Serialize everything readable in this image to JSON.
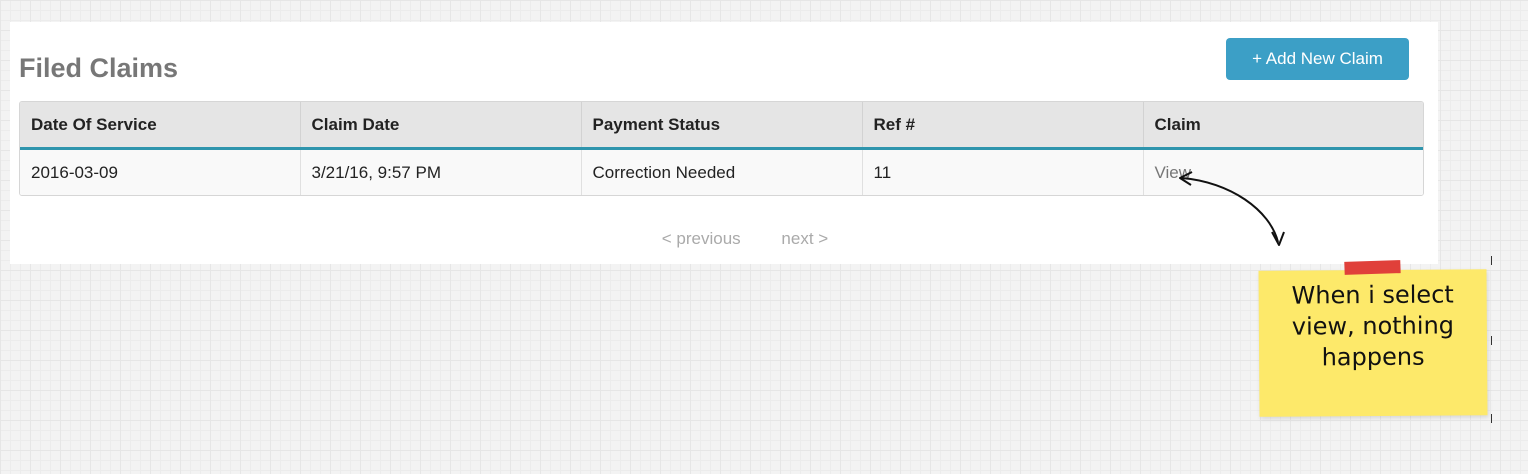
{
  "page": {
    "title": "Filed Claims",
    "add_button_label": "+ Add New Claim"
  },
  "table": {
    "headers": [
      "Date Of Service",
      "Claim Date",
      "Payment Status",
      "Ref #",
      "Claim"
    ],
    "rows": [
      {
        "date_of_service": "2016-03-09",
        "claim_date": "3/21/16, 9:57 PM",
        "payment_status": "Correction Needed",
        "ref": "11",
        "claim_link": "View"
      }
    ]
  },
  "pagination": {
    "previous_label": "< previous",
    "next_label": "next >"
  },
  "annotation": {
    "note_lines": [
      "When i select",
      "view, nothing",
      "happens"
    ]
  },
  "colors": {
    "accent": "#3c9fc6",
    "header_border": "#2f95ad",
    "sticky_note": "#fde96a",
    "tape": "#e0403a"
  }
}
